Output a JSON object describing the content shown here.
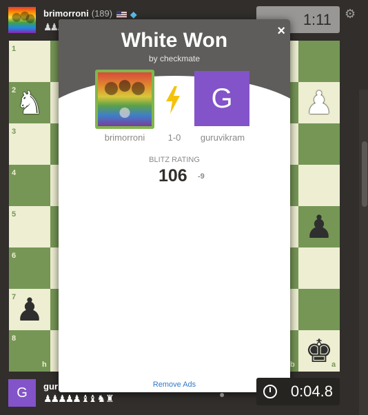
{
  "top_player": {
    "name": "brimorroni",
    "rating": "(189)",
    "captured": "♟♟♟",
    "clock": "1:11"
  },
  "bottom_player": {
    "avatar_letter": "G",
    "name": "gur",
    "captured": "♟♟♟♟♟ ♝♝ ♞ ♜",
    "clock": "0:04.8"
  },
  "board": {
    "coords": {
      "ranks": [
        "1",
        "2",
        "3",
        "4",
        "5",
        "6",
        "7",
        "8"
      ],
      "file_left": "h",
      "file_b": "b",
      "file_a": "a"
    }
  },
  "modal": {
    "close_label": "×",
    "title": "White Won",
    "subtitle": "by checkmate",
    "white_player": "brimorroni",
    "score": "1-0",
    "black_player": "guruvikram",
    "black_avatar_letter": "G",
    "rating_label": "BLITZ RATING",
    "rating_value": "106",
    "rating_change": "-9",
    "remove_ads": "Remove Ads"
  },
  "colors": {
    "light_square": "#eeeed2",
    "dark_square": "#769656",
    "accent_green": "#81b64c",
    "avatar_purple": "#8353c9",
    "link_blue": "#3178c6"
  }
}
